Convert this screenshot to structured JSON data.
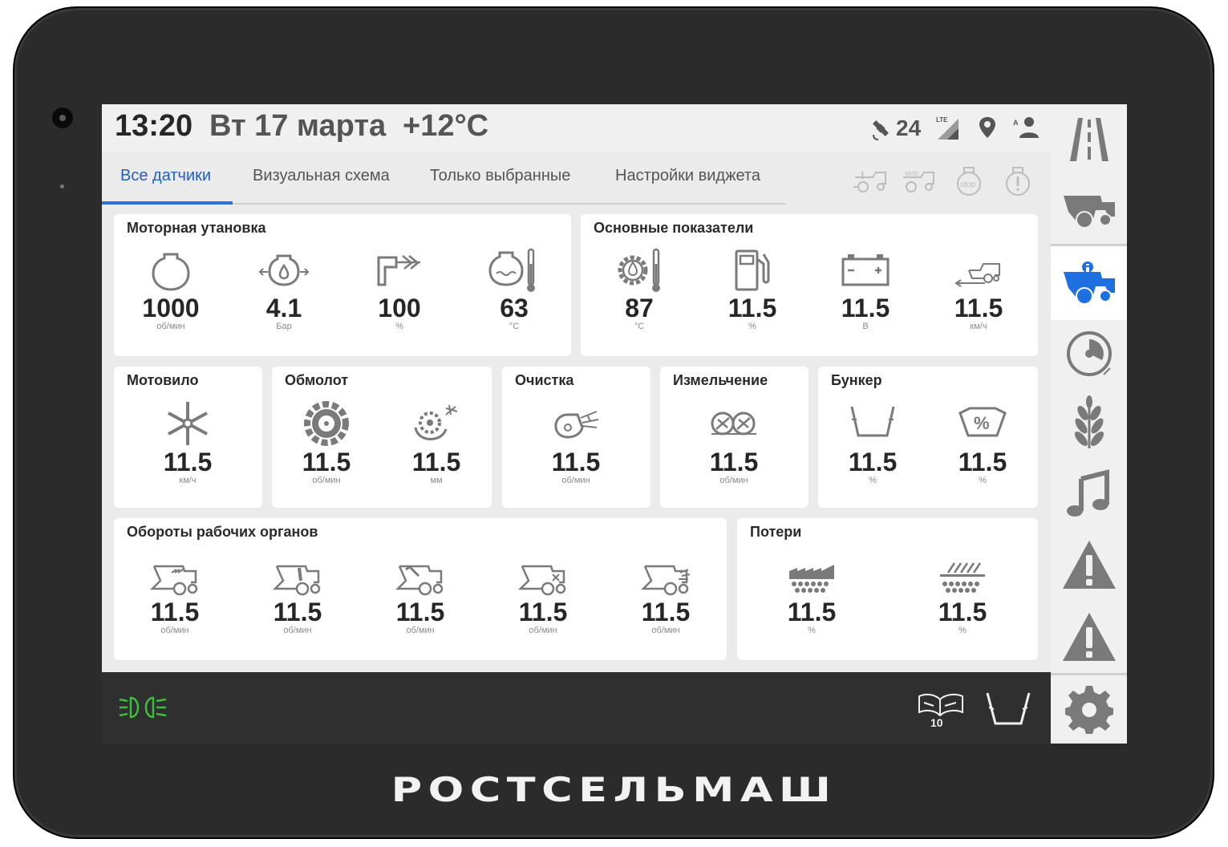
{
  "brand": "РОСТСЕЛЬМАШ",
  "status": {
    "time": "13:20",
    "date": "Вт 17 марта",
    "temperature": "+12°C",
    "satellites": "24",
    "network": "LTE"
  },
  "tabs": [
    {
      "label": "Все датчики",
      "active": true
    },
    {
      "label": "Визуальная схема",
      "active": false
    },
    {
      "label": "Только выбранные",
      "active": false
    },
    {
      "label": "Настройки виджета",
      "active": false
    }
  ],
  "header_icons": [
    "harvester-warning-icon",
    "harvester-stop-icon",
    "stop-icon",
    "alert-icon"
  ],
  "cards": {
    "engine": {
      "title": "Моторная утановка",
      "items": [
        {
          "icon": "engine-icon",
          "value": "1000",
          "unit": "об/мин"
        },
        {
          "icon": "oil-pressure-icon",
          "value": "4.1",
          "unit": "Бар"
        },
        {
          "icon": "air-intake-icon",
          "value": "100",
          "unit": "%"
        },
        {
          "icon": "coolant-temperature-icon",
          "value": "63",
          "unit": "°C"
        }
      ]
    },
    "main": {
      "title": "Основные показатели",
      "items": [
        {
          "icon": "oil-temperature-icon",
          "value": "87",
          "unit": "°C"
        },
        {
          "icon": "fuel-icon",
          "value": "11.5",
          "unit": "%"
        },
        {
          "icon": "battery-icon",
          "value": "11.5",
          "unit": "В"
        },
        {
          "icon": "speed-icon",
          "value": "11.5",
          "unit": "км/ч"
        }
      ]
    },
    "reel": {
      "title": "Мотовило",
      "items": [
        {
          "icon": "reel-icon",
          "value": "11.5",
          "unit": "км/ч"
        }
      ]
    },
    "threshing": {
      "title": "Обмолот",
      "items": [
        {
          "icon": "drum-icon",
          "value": "11.5",
          "unit": "об/мин"
        },
        {
          "icon": "concave-icon",
          "value": "11.5",
          "unit": "мм"
        }
      ]
    },
    "cleaning": {
      "title": "Очистка",
      "items": [
        {
          "icon": "fan-icon",
          "value": "11.5",
          "unit": "об/мин"
        }
      ]
    },
    "chopping": {
      "title": "Измельчение",
      "items": [
        {
          "icon": "chopper-icon",
          "value": "11.5",
          "unit": "об/мин"
        }
      ]
    },
    "bunker": {
      "title": "Бункер",
      "items": [
        {
          "icon": "bunker-icon",
          "value": "11.5",
          "unit": "%"
        },
        {
          "icon": "bunker-percent-icon",
          "value": "11.5",
          "unit": "%"
        }
      ]
    },
    "rpm": {
      "title": "Обороты рабочих органов",
      "items": [
        {
          "icon": "harvester-header-icon",
          "value": "11.5",
          "unit": "об/мин"
        },
        {
          "icon": "harvester-feeder-icon",
          "value": "11.5",
          "unit": "об/мин"
        },
        {
          "icon": "harvester-elevator-icon",
          "value": "11.5",
          "unit": "об/мин"
        },
        {
          "icon": "harvester-x-icon",
          "value": "11.5",
          "unit": "об/мин"
        },
        {
          "icon": "harvester-rear-icon",
          "value": "11.5",
          "unit": "об/мин"
        }
      ]
    },
    "losses": {
      "title": "Потери",
      "items": [
        {
          "icon": "sieve-loss-icon",
          "value": "11.5",
          "unit": "%"
        },
        {
          "icon": "straw-walker-loss-icon",
          "value": "11.5",
          "unit": "%"
        }
      ]
    }
  },
  "sidebar": [
    "road-icon",
    "harvester-icon",
    "harvester-info-icon",
    "gauge-icon",
    "wheat-icon",
    "music-icon",
    "warning-icon",
    "warning-icon",
    "settings-icon"
  ],
  "bottom": {
    "lights_icon": "headlights-icon",
    "manual_badge": "10"
  },
  "colors": {
    "accent": "#2a72d8",
    "active_icon": "#1e6fe0",
    "icon_gray": "#7a7a7a",
    "lights_green": "#3bbf3b"
  }
}
